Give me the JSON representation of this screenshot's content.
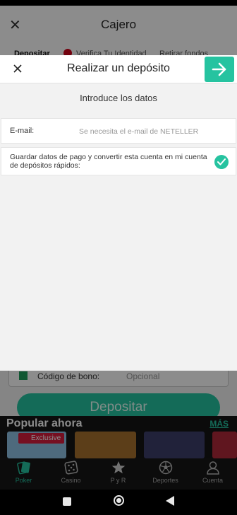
{
  "background": {
    "title": "Cajero",
    "tabs": [
      "Depositar",
      "Verifica Tu Identidad",
      "Retirar fondos"
    ],
    "bonus_label": "Código de bono:",
    "bonus_placeholder": "Opcional",
    "deposit_button": "Depositar",
    "popular_title": "Popular ahora",
    "popular_more": "MÁS",
    "tile_badge": "Exclusive"
  },
  "modal": {
    "title": "Realizar un depósito",
    "section_title": "Introduce los datos",
    "email_label": "E-mail:",
    "email_placeholder": "Se necesita el e-mail de NETELLER",
    "email_value": "",
    "save_label": "Guardar datos de pago y convertir esta cuenta en mi cuenta de depósitos rápidos:",
    "save_checked": true
  },
  "bottom_nav": [
    {
      "label": "Poker",
      "icon": "poker-cards-icon",
      "active": true
    },
    {
      "label": "Casino",
      "icon": "dice-icon",
      "active": false
    },
    {
      "label": "P y R",
      "icon": "star-icon",
      "active": false
    },
    {
      "label": "Deportes",
      "icon": "soccer-ball-icon",
      "active": false
    },
    {
      "label": "Cuenta",
      "icon": "user-icon",
      "active": false
    }
  ],
  "colors": {
    "accent": "#26c3a0",
    "alert": "#d0021b",
    "badge": "#d81d3c"
  }
}
